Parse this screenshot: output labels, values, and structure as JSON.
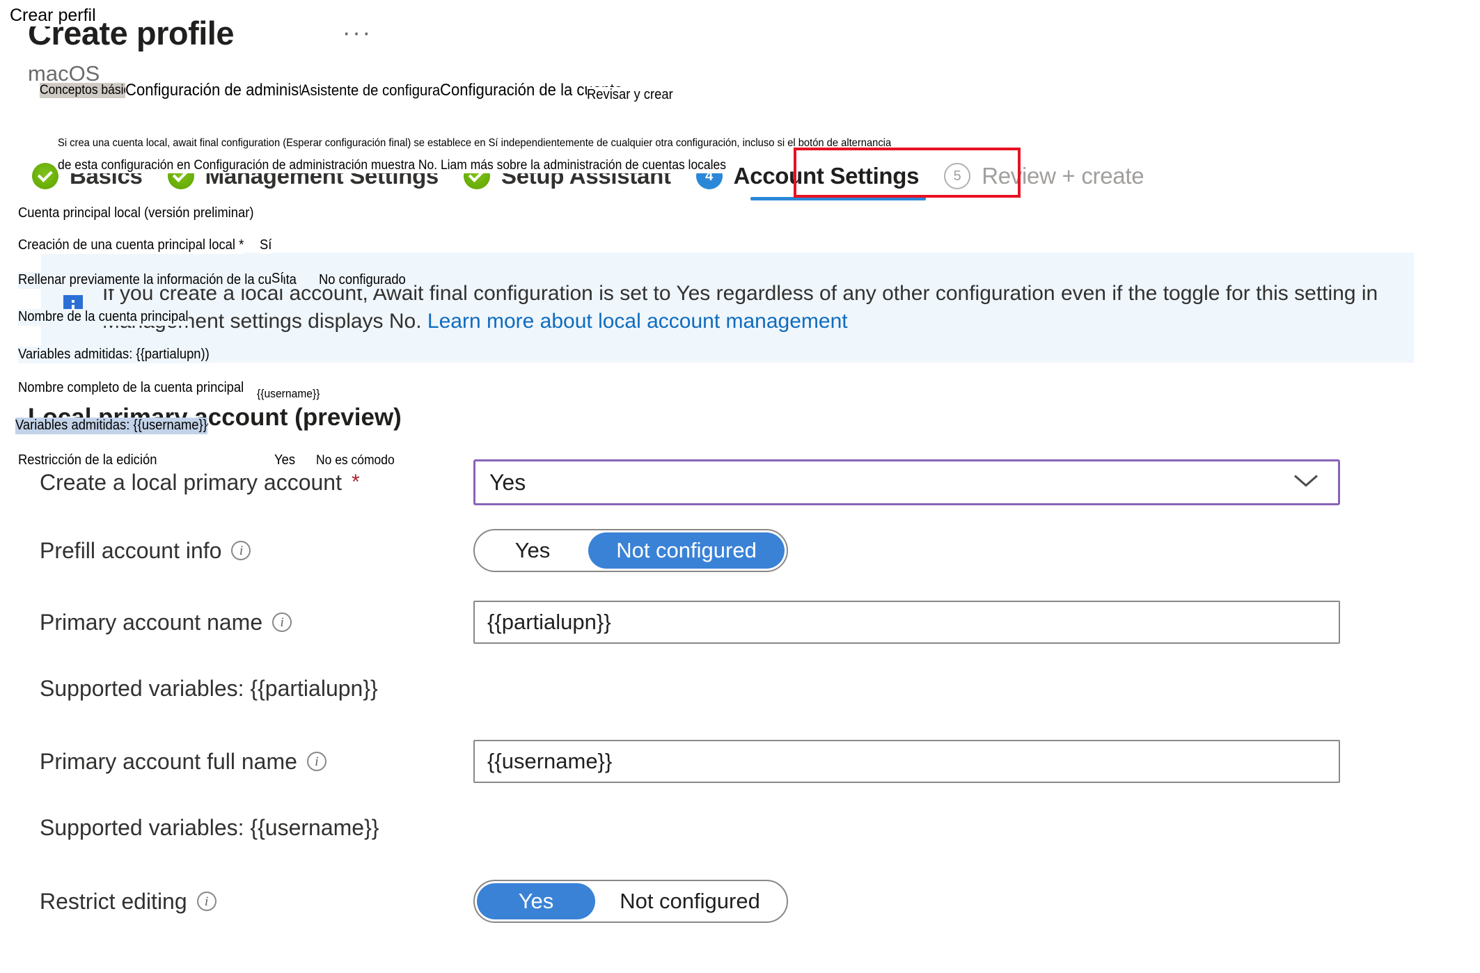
{
  "window": {
    "overlay_title": "Crear perfil",
    "title": "Create profile",
    "title_ellipsis": "···",
    "platform": "macOS"
  },
  "colors": {
    "accent_blue": "#2b88d8",
    "toggle_blue": "#3a82d6",
    "success_green": "#6bb700",
    "highlight_red": "#e81123",
    "focus_purple": "#8764b8",
    "info_banner_bg": "#eff6fc",
    "link_blue": "#0f6cbd",
    "required_red": "#a4262c"
  },
  "steps": [
    {
      "id": "basics",
      "number": "1",
      "label": "Basics",
      "state": "done",
      "es_label": "Conceptos básicos"
    },
    {
      "id": "management-settings",
      "number": "2",
      "label": "Management Settings",
      "state": "done",
      "es_label": "Configuración de administración"
    },
    {
      "id": "setup-assistant",
      "number": "3",
      "label": "Setup Assistant",
      "state": "done",
      "es_label": "Asistente de configuración"
    },
    {
      "id": "account-settings",
      "number": "4",
      "label": "Account Settings",
      "state": "current",
      "es_label": "Configuración de la cuenta"
    },
    {
      "id": "review-create",
      "number": "5",
      "label": "Review + create",
      "state": "upcoming",
      "es_label": "Revisar y crear"
    }
  ],
  "info_banner": {
    "icon": "info-icon",
    "text_part1": "If you create a local account, Await final configuration is set to Yes regardless of any other configuration even if the toggle for this setting in Management settings displays No. ",
    "link_text": "Learn more about local account management",
    "es_line1": "Si crea una cuenta local, await final configuration (Esperar configuración final) se establece en Sí independientemente de cualquier otra configuración, incluso si el botón de alternancia",
    "es_line2": "de esta configuración en Configuración de administración muestra No. Liam más sobre la administración de cuentas locales"
  },
  "section": {
    "heading": "Local primary account (preview)",
    "es_heading": "Cuenta principal local (versión preliminar)"
  },
  "form": {
    "create_local_primary_account": {
      "label": "Create a local primary account",
      "required_mark": "*",
      "value": "Yes",
      "es_label": "Creación de una cuenta principal local *",
      "es_value": "Sí"
    },
    "prefill_account_info": {
      "label": "Prefill account info",
      "options": [
        "Yes",
        "Not configured"
      ],
      "selected": "Not configured",
      "es_label": "Rellenar previamente la información de la cuenta",
      "es_options": [
        "Sí",
        "No configurado"
      ]
    },
    "primary_account_name": {
      "label": "Primary account name",
      "value": "{{partialupn}}",
      "supported_variables": "Supported variables: {{partialupn}}",
      "es_label": "Nombre de la cuenta principal",
      "es_supported_variables": "Variables admitidas: {{partialupn))"
    },
    "primary_account_full_name": {
      "label": "Primary account full name",
      "value": "{{username}}",
      "supported_variables": "Supported variables: {{username}}",
      "es_label": "Nombre completo de la cuenta principal",
      "es_value": "{{username}}",
      "es_supported_variables": "Variables admitidas: {{username}}"
    },
    "restrict_editing": {
      "label": "Restrict editing",
      "options": [
        "Yes",
        "Not configured"
      ],
      "selected": "Yes",
      "es_label": "Restricción de la edición",
      "es_options": [
        "Yes",
        "No es cómodo"
      ]
    }
  }
}
